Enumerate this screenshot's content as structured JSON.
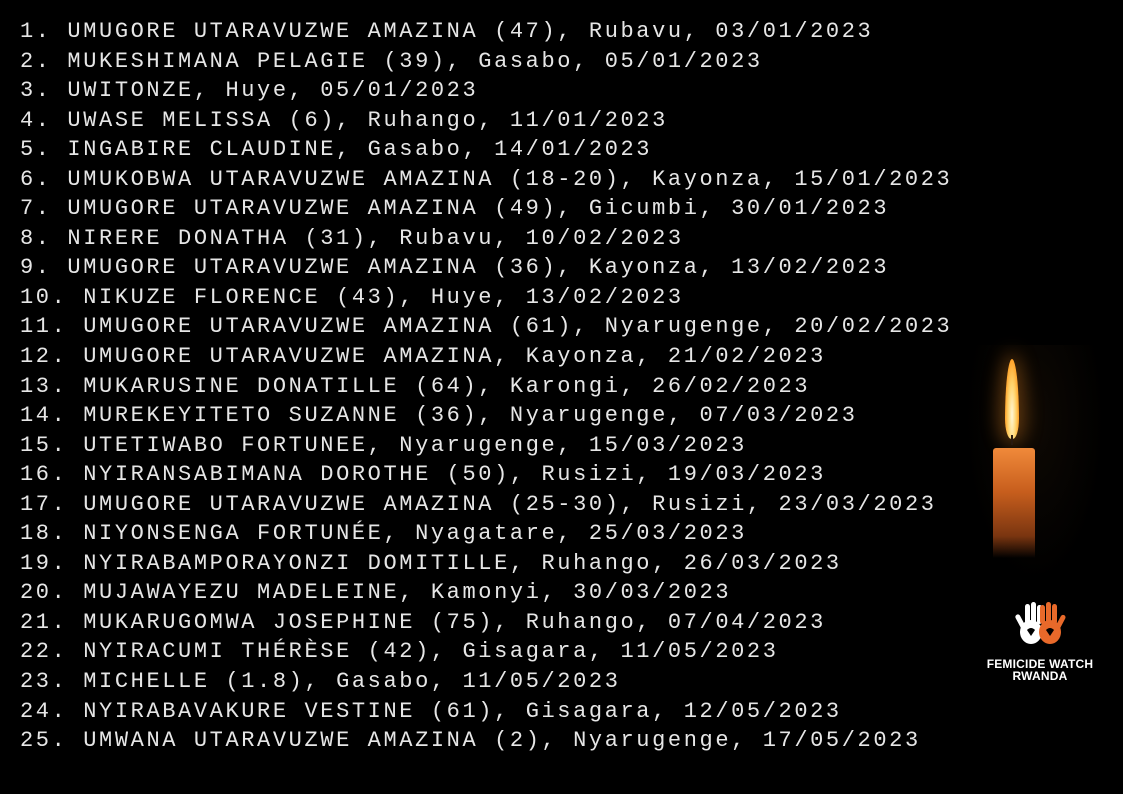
{
  "victims": [
    {
      "num": "1.",
      "text": "UMUGORE UTARAVUZWE AMAZINA (47), Rubavu, 03/01/2023"
    },
    {
      "num": "2.",
      "text": "MUKESHIMANA PELAGIE (39), Gasabo, 05/01/2023"
    },
    {
      "num": "3.",
      "text": "UWITONZE, Huye, 05/01/2023"
    },
    {
      "num": "4.",
      "text": "UWASE MELISSA (6), Ruhango, 11/01/2023"
    },
    {
      "num": "5.",
      "text": "INGABIRE CLAUDINE, Gasabo, 14/01/2023"
    },
    {
      "num": "6.",
      "text": "UMUKOBWA UTARAVUZWE AMAZINA (18-20), Kayonza, 15/01/2023"
    },
    {
      "num": "7.",
      "text": "UMUGORE UTARAVUZWE AMAZINA (49), Gicumbi, 30/01/2023"
    },
    {
      "num": "8.",
      "text": "NIRERE DONATHA (31), Rubavu, 10/02/2023"
    },
    {
      "num": "9.",
      "text": "UMUGORE UTARAVUZWE AMAZINA (36), Kayonza, 13/02/2023"
    },
    {
      "num": "10.",
      "text": "NIKUZE FLORENCE (43), Huye, 13/02/2023"
    },
    {
      "num": "11.",
      "text": "UMUGORE UTARAVUZWE AMAZINA (61), Nyarugenge, 20/02/2023"
    },
    {
      "num": "12.",
      "text": "UMUGORE UTARAVUZWE AMAZINA, Kayonza, 21/02/2023"
    },
    {
      "num": "13.",
      "text": "MUKARUSINE DONATILLE (64), Karongi, 26/02/2023"
    },
    {
      "num": "14.",
      "text": "MUREKEYITETO SUZANNE (36), Nyarugenge, 07/03/2023"
    },
    {
      "num": "15.",
      "text": "UTETIWABO FORTUNEE, Nyarugenge, 15/03/2023"
    },
    {
      "num": "16.",
      "text": "NYIRANSABIMANA DOROTHE (50), Rusizi, 19/03/2023"
    },
    {
      "num": "17.",
      "text": "UMUGORE UTARAVUZWE AMAZINA (25-30), Rusizi, 23/03/2023"
    },
    {
      "num": "18.",
      "text": "NIYONSENGA FORTUNÉE, Nyagatare, 25/03/2023"
    },
    {
      "num": "19.",
      "text": "NYIRABAMPORAYONZI DOMITILLE, Ruhango, 26/03/2023"
    },
    {
      "num": "20.",
      "text": "MUJAWAYEZU MADELEINE, Kamonyi, 30/03/2023"
    },
    {
      "num": "21.",
      "text": "MUKARUGOMWA JOSEPHINE (75), Ruhango, 07/04/2023"
    },
    {
      "num": "22.",
      "text": "NYIRACUMI THÉRÈSE (42), Gisagara, 11/05/2023"
    },
    {
      "num": "23.",
      "text": "MICHELLE (1.8), Gasabo, 11/05/2023"
    },
    {
      "num": "24.",
      "text": "NYIRABAVAKURE VESTINE (61), Gisagara, 12/05/2023"
    },
    {
      "num": "25.",
      "text": "UMWANA UTARAVUZWE AMAZINA (2), Nyarugenge, 17/05/2023"
    }
  ],
  "logo": {
    "line1": "FEMICIDE WATCH",
    "line2": "RWANDA"
  },
  "colors": {
    "background": "#000000",
    "text": "#e6e6e6",
    "accent_orange": "#e8692a"
  }
}
